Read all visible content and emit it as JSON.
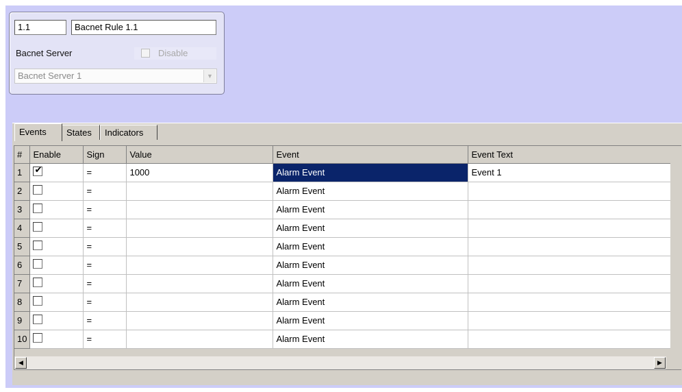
{
  "rule": {
    "id": "1.1",
    "name": "Bacnet Rule 1.1",
    "server_label": "Bacnet Server",
    "disable_label": "Disable",
    "disable_checked": false,
    "server_selected": "Bacnet Server 1"
  },
  "tabs": [
    {
      "label": "Events",
      "active": true
    },
    {
      "label": "States",
      "active": false
    },
    {
      "label": "Indicators",
      "active": false
    }
  ],
  "table": {
    "headers": [
      "#",
      "Enable",
      "Sign",
      "Value",
      "Event",
      "Event Text"
    ],
    "rows": [
      {
        "num": "1",
        "enabled": true,
        "sign": "=",
        "value": "1000",
        "event": "Alarm Event",
        "text": "Event 1",
        "selected_cell": "event"
      },
      {
        "num": "2",
        "enabled": false,
        "sign": "=",
        "value": "",
        "event": "Alarm Event",
        "text": ""
      },
      {
        "num": "3",
        "enabled": false,
        "sign": "=",
        "value": "",
        "event": "Alarm Event",
        "text": ""
      },
      {
        "num": "4",
        "enabled": false,
        "sign": "=",
        "value": "",
        "event": "Alarm Event",
        "text": ""
      },
      {
        "num": "5",
        "enabled": false,
        "sign": "=",
        "value": "",
        "event": "Alarm Event",
        "text": ""
      },
      {
        "num": "6",
        "enabled": false,
        "sign": "=",
        "value": "",
        "event": "Alarm Event",
        "text": ""
      },
      {
        "num": "7",
        "enabled": false,
        "sign": "=",
        "value": "",
        "event": "Alarm Event",
        "text": ""
      },
      {
        "num": "8",
        "enabled": false,
        "sign": "=",
        "value": "",
        "event": "Alarm Event",
        "text": ""
      },
      {
        "num": "9",
        "enabled": false,
        "sign": "=",
        "value": "",
        "event": "Alarm Event",
        "text": ""
      },
      {
        "num": "10",
        "enabled": false,
        "sign": "=",
        "value": "",
        "event": "Alarm Event",
        "text": ""
      }
    ]
  },
  "icons": {
    "dropdown": "chevron-down-icon",
    "scroll_left": "arrow-left-icon",
    "scroll_right": "arrow-right-icon",
    "check": "checkmark-icon"
  },
  "colors": {
    "background": "#ccccf8",
    "selection": "#0a246a"
  }
}
